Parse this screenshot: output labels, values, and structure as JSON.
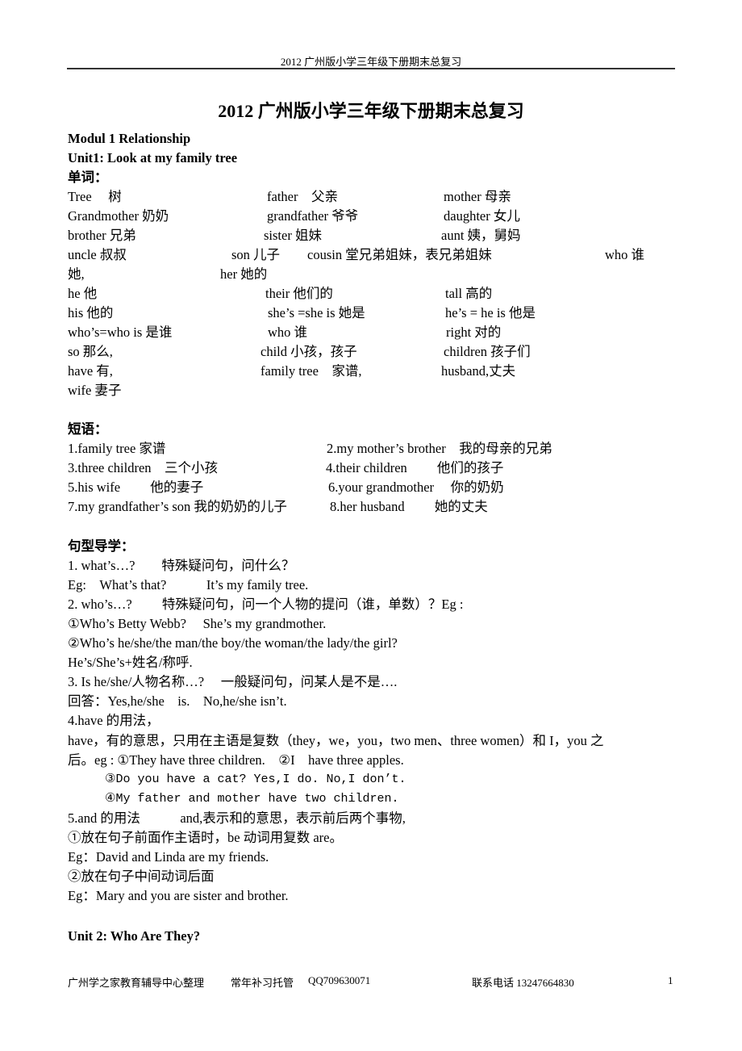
{
  "header": {
    "running_title": "2012 广州版小学三年级下册期末总复习"
  },
  "title": "2012 广州版小学三年级下册期末总复习",
  "module": "Modul 1 Relationship",
  "unit1": {
    "heading": "Unit1: Look at my family tree",
    "vocab_heading": "单词：",
    "vocab_rows": [
      [
        "Tree　 树",
        "father　父亲",
        "mother 母亲"
      ],
      [
        "Grandmother  奶奶",
        "grandfather 爷爷",
        "daughter 女儿"
      ],
      [
        "brother 兄弟",
        "sister 姐妹",
        "aunt 姨，舅妈"
      ],
      [
        "uncle 叔叔",
        "son 儿子",
        "cousin 堂兄弟姐妹，表兄弟姐妹",
        "who 谁"
      ],
      [
        "她,",
        "her 她的"
      ],
      [
        "he 他",
        "their 他们的",
        "tall 高的"
      ],
      [
        "his 他的",
        "she’s =she is 她是",
        "he’s = he is 他是"
      ],
      [
        "who’s=who is 是谁",
        "who 谁",
        "right 对的"
      ],
      [
        "so 那么,",
        "child 小孩，孩子",
        "children 孩子们"
      ],
      [
        "have 有,",
        "family tree　家谱,",
        "husband,丈夫"
      ],
      [
        "wife 妻子"
      ]
    ],
    "phrases_heading": "短语：",
    "phrases": [
      [
        "1.family tree 家谱",
        "2.my mother’s brother　我的母亲的兄弟"
      ],
      [
        "3.three children　三个小孩",
        "4.their children　　 他们的孩子"
      ],
      [
        "5.his wife　　 他的妻子",
        "6.your grandmother　 你的奶奶"
      ],
      [
        "7.my grandfather’s son  我的奶奶的儿子",
        "8.her husband　　 她的丈夫"
      ]
    ],
    "sentences_heading": "句型导学：",
    "sentences": [
      "1.  what’s…?　　特殊疑问句，问什么？",
      "Eg:　What’s that?　　　It’s my family tree.",
      "2.  who’s…?　　 特殊疑问句，问一个人物的提问（谁，单数）？Eg :",
      " ①Who’s Betty Webb?　 She’s my grandmother.",
      " ②Who’s he/she/the man/the boy/the woman/the lady/the girl?",
      "    He’s/She’s+姓名/称呼.",
      "3. Is he/she/人物名称…?　 一般疑问句，问某人是不是….",
      "  回答：Yes,he/she　is.　No,he/she isn’t.",
      "4.have 的用法，",
      "have，有的意思，只用在主语是复数（they，we，you，two men、three women）和 I，you 之",
      "后。eg :  ①They have three children.　②I　have three apples.",
      "③Do you have a cat?     Yes,I do.    No,I don’t.",
      "④My father and mother have two children.",
      "5.and 的用法　　　and,表示和的意思，表示前后两个事物,",
      "①放在句子前面作主语时，be 动词用复数 are。",
      "Eg：David and Linda are my friends.",
      "②放在句子中间动词后面",
      "Eg：Mary and you are sister and brother."
    ]
  },
  "unit2": {
    "heading": "Unit 2: Who Are They?"
  },
  "footer": {
    "org": "广州学之家教育辅导中心整理",
    "service": "常年补习托管",
    "qq": "QQ709630071",
    "phone": "联系电话 13247664830",
    "page_number": "1"
  }
}
